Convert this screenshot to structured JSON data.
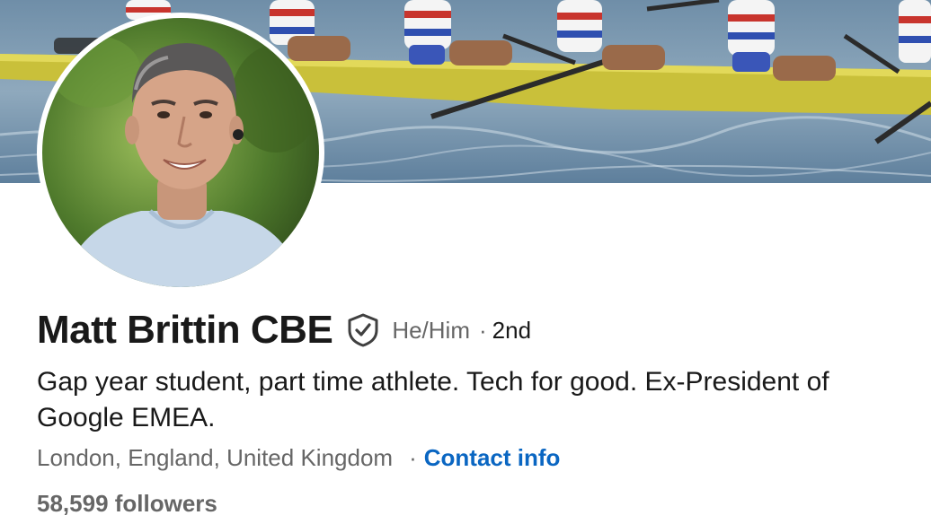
{
  "profile": {
    "name": "Matt Brittin CBE",
    "verified_icon": "shield-check-icon",
    "pronouns": "He/Him",
    "degree_separator": "·",
    "connection_degree": "2nd",
    "headline": "Gap year student, part time athlete. Tech for good. Ex-President of Google EMEA.",
    "location": "London, England, United Kingdom",
    "location_separator": "·",
    "contact_info_label": "Contact info",
    "followers": "58,599 followers"
  },
  "colors": {
    "link_blue": "#0a66c2",
    "secondary_text": "#666666",
    "primary_text": "#191919"
  }
}
